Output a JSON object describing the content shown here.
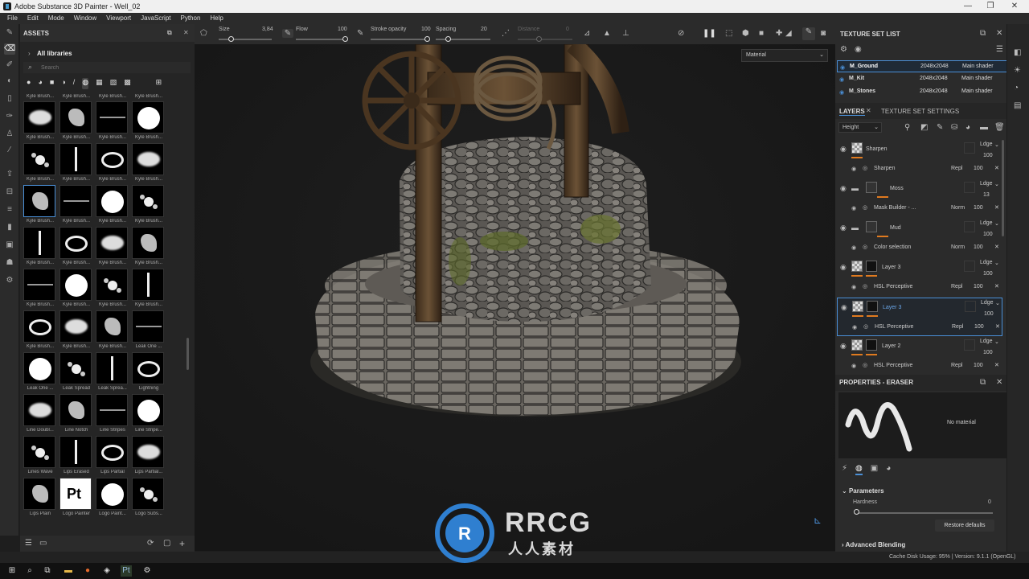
{
  "window": {
    "title": "Adobe Substance 3D Painter - Well_02"
  },
  "menu": [
    "File",
    "Edit",
    "Mode",
    "Window",
    "Viewport",
    "JavaScript",
    "Python",
    "Help"
  ],
  "toolbar": {
    "size_label": "Size",
    "size_value": "3,84",
    "flow_label": "Flow",
    "flow_value": "100",
    "stroke_label": "Stroke opacity",
    "stroke_value": "100",
    "spacing_label": "Spacing",
    "spacing_value": "20",
    "distance_label": "Distance",
    "distance_value": "0"
  },
  "assets": {
    "title": "ASSETS",
    "breadcrumb": "All libraries",
    "search_placeholder": "Search",
    "top_row_labels": [
      "Kyle Brush...",
      "Kyle Brush...",
      "Kyle Brush...",
      "Kyle Brush..."
    ],
    "rows": [
      [
        "Kyle Brush...",
        "Kyle Brush...",
        "Kyle Brush...",
        "Kyle Brush..."
      ],
      [
        "Kyle Brush...",
        "Kyle Brush...",
        "Kyle Brush...",
        "Kyle Brush..."
      ],
      [
        "Kyle Brush...",
        "Kyle Brush...",
        "Kyle Brush...",
        "Kyle Brush..."
      ],
      [
        "Kyle Brush...",
        "Kyle Brush...",
        "Kyle Brush...",
        "Kyle Brush..."
      ],
      [
        "Kyle Brush...",
        "Kyle Brush...",
        "Kyle Brush...",
        "Kyle Brush..."
      ],
      [
        "Kyle Brush...",
        "Kyle Brush...",
        "Kyle Brush...",
        "Leak One ..."
      ],
      [
        "Leak One ...",
        "Leak Spread",
        "Leak Sprea...",
        "Lightning"
      ],
      [
        "Line Doubl...",
        "Line Notch",
        "Line Stripes",
        "Line Stripe..."
      ],
      [
        "Lines Wave",
        "Lips Erased",
        "Lips Partial",
        "Lips Partial..."
      ],
      [
        "Lips Plain",
        "Logo Painter",
        "Logo Paint...",
        "Logo Subs..."
      ]
    ],
    "logo_text": "Pt"
  },
  "viewport": {
    "material_select": "Material"
  },
  "texture_set_list": {
    "title": "TEXTURE SET LIST",
    "sets": [
      {
        "name": "M_Ground",
        "res": "2048x2048",
        "shader": "Main shader"
      },
      {
        "name": "M_Kit",
        "res": "2048x2048",
        "shader": "Main shader"
      },
      {
        "name": "M_Stones",
        "res": "2048x2048",
        "shader": "Main shader"
      }
    ]
  },
  "layers": {
    "tab_layers": "LAYERS",
    "tab_settings": "TEXTURE SET SETTINGS",
    "channel": "Height",
    "items": [
      {
        "name": "Sharpen",
        "blend": "Ldge",
        "opacity": "100",
        "effect": "Sharpen",
        "effect_blend": "Repl",
        "effect_opacity": "100"
      },
      {
        "name": "Moss",
        "blend": "Ldge",
        "opacity": "13",
        "effect": "Mask Builder - ...",
        "effect_blend": "Norm",
        "effect_opacity": "100"
      },
      {
        "name": "Mud",
        "blend": "Ldge",
        "opacity": "100",
        "effect": "Color selection",
        "effect_blend": "Norm",
        "effect_opacity": "100"
      },
      {
        "name": "Layer 3",
        "blend": "Ldge",
        "opacity": "100",
        "effect": "HSL Perceptive",
        "effect_blend": "Repl",
        "effect_opacity": "100"
      },
      {
        "name": "Layer 3",
        "blend": "Ldge",
        "opacity": "100",
        "effect": "HSL Perceptive",
        "effect_blend": "Repl",
        "effect_opacity": "100"
      },
      {
        "name": "Layer 2",
        "blend": "Ldge",
        "opacity": "100",
        "effect": "HSL Perceptive",
        "effect_blend": "Repl",
        "effect_opacity": "100"
      }
    ]
  },
  "properties": {
    "title": "PROPERTIES - ERASER",
    "no_material": "No material",
    "parameters": "Parameters",
    "hardness_label": "Hardness",
    "hardness_value": "0",
    "restore": "Restore defaults",
    "advanced": "Advanced Blending"
  },
  "status": {
    "text": "Cache Disk Usage:  95% | Version: 9.1.1 (OpenGL)"
  },
  "watermark": {
    "main": "RRCG",
    "sub": "人人素材"
  },
  "colors": {
    "accent": "#4a8fd6",
    "orange": "#e07a1f",
    "selected_border": "#4a8fd6"
  }
}
